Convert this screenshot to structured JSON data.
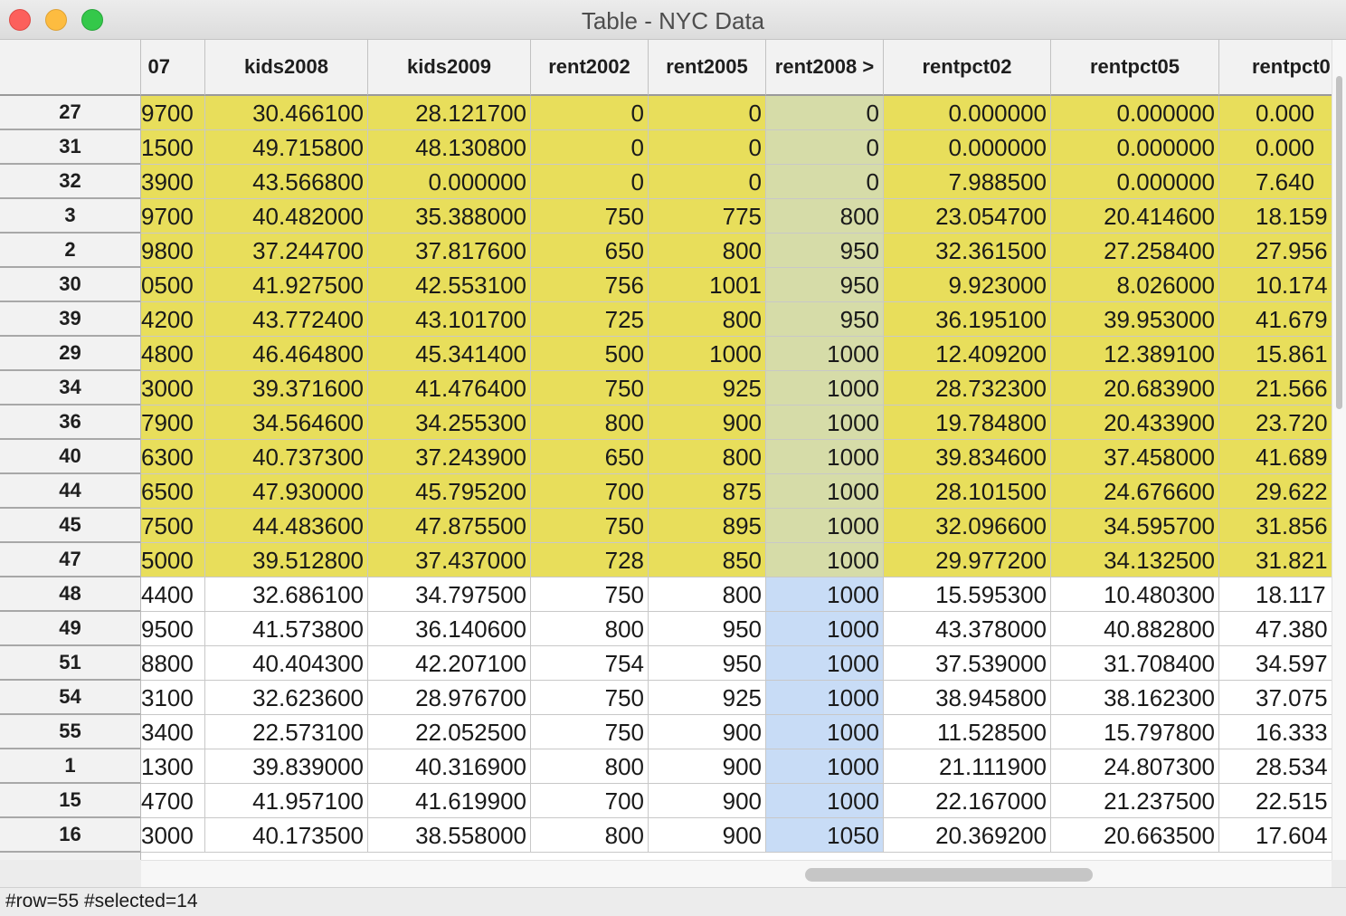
{
  "window": {
    "title": "Table - NYC Data"
  },
  "columns": [
    "07",
    "kids2008",
    "kids2009",
    "rent2002",
    "rent2005",
    "rent2008 >",
    "rentpct02",
    "rentpct05",
    "rentpct0"
  ],
  "rows": [
    {
      "id": "27",
      "selected": true,
      "cells": [
        "9700",
        "30.466100",
        "28.121700",
        "0",
        "0",
        "0",
        "0.000000",
        "0.000000",
        "0.000"
      ]
    },
    {
      "id": "31",
      "selected": true,
      "cells": [
        "1500",
        "49.715800",
        "48.130800",
        "0",
        "0",
        "0",
        "0.000000",
        "0.000000",
        "0.000"
      ]
    },
    {
      "id": "32",
      "selected": true,
      "cells": [
        "3900",
        "43.566800",
        "0.000000",
        "0",
        "0",
        "0",
        "7.988500",
        "0.000000",
        "7.640"
      ]
    },
    {
      "id": "3",
      "selected": true,
      "cells": [
        "9700",
        "40.482000",
        "35.388000",
        "750",
        "775",
        "800",
        "23.054700",
        "20.414600",
        "18.159"
      ]
    },
    {
      "id": "2",
      "selected": true,
      "cells": [
        "9800",
        "37.244700",
        "37.817600",
        "650",
        "800",
        "950",
        "32.361500",
        "27.258400",
        "27.956"
      ]
    },
    {
      "id": "30",
      "selected": true,
      "cells": [
        "0500",
        "41.927500",
        "42.553100",
        "756",
        "1001",
        "950",
        "9.923000",
        "8.026000",
        "10.174"
      ]
    },
    {
      "id": "39",
      "selected": true,
      "cells": [
        "4200",
        "43.772400",
        "43.101700",
        "725",
        "800",
        "950",
        "36.195100",
        "39.953000",
        "41.679"
      ]
    },
    {
      "id": "29",
      "selected": true,
      "cells": [
        "4800",
        "46.464800",
        "45.341400",
        "500",
        "1000",
        "1000",
        "12.409200",
        "12.389100",
        "15.861"
      ]
    },
    {
      "id": "34",
      "selected": true,
      "cells": [
        "3000",
        "39.371600",
        "41.476400",
        "750",
        "925",
        "1000",
        "28.732300",
        "20.683900",
        "21.566"
      ]
    },
    {
      "id": "36",
      "selected": true,
      "cells": [
        "7900",
        "34.564600",
        "34.255300",
        "800",
        "900",
        "1000",
        "19.784800",
        "20.433900",
        "23.720"
      ]
    },
    {
      "id": "40",
      "selected": true,
      "cells": [
        "6300",
        "40.737300",
        "37.243900",
        "650",
        "800",
        "1000",
        "39.834600",
        "37.458000",
        "41.689"
      ]
    },
    {
      "id": "44",
      "selected": true,
      "cells": [
        "6500",
        "47.930000",
        "45.795200",
        "700",
        "875",
        "1000",
        "28.101500",
        "24.676600",
        "29.622"
      ]
    },
    {
      "id": "45",
      "selected": true,
      "cells": [
        "7500",
        "44.483600",
        "47.875500",
        "750",
        "895",
        "1000",
        "32.096600",
        "34.595700",
        "31.856"
      ]
    },
    {
      "id": "47",
      "selected": true,
      "cells": [
        "5000",
        "39.512800",
        "37.437000",
        "728",
        "850",
        "1000",
        "29.977200",
        "34.132500",
        "31.821"
      ]
    },
    {
      "id": "48",
      "selected": false,
      "cells": [
        "4400",
        "32.686100",
        "34.797500",
        "750",
        "800",
        "1000",
        "15.595300",
        "10.480300",
        "18.117"
      ]
    },
    {
      "id": "49",
      "selected": false,
      "cells": [
        "9500",
        "41.573800",
        "36.140600",
        "800",
        "950",
        "1000",
        "43.378000",
        "40.882800",
        "47.380"
      ]
    },
    {
      "id": "51",
      "selected": false,
      "cells": [
        "8800",
        "40.404300",
        "42.207100",
        "754",
        "950",
        "1000",
        "37.539000",
        "31.708400",
        "34.597"
      ]
    },
    {
      "id": "54",
      "selected": false,
      "cells": [
        "3100",
        "32.623600",
        "28.976700",
        "750",
        "925",
        "1000",
        "38.945800",
        "38.162300",
        "37.075"
      ]
    },
    {
      "id": "55",
      "selected": false,
      "cells": [
        "3400",
        "22.573100",
        "22.052500",
        "750",
        "900",
        "1000",
        "11.528500",
        "15.797800",
        "16.333"
      ]
    },
    {
      "id": "1",
      "selected": false,
      "cells": [
        "1300",
        "39.839000",
        "40.316900",
        "800",
        "900",
        "1000",
        "21.111900",
        "24.807300",
        "28.534"
      ]
    },
    {
      "id": "15",
      "selected": false,
      "cells": [
        "4700",
        "41.957100",
        "41.619900",
        "700",
        "900",
        "1000",
        "22.167000",
        "21.237500",
        "22.515"
      ]
    },
    {
      "id": "16",
      "selected": false,
      "cells": [
        "3000",
        "40.173500",
        "38.558000",
        "800",
        "900",
        "1050",
        "20.369200",
        "20.663500",
        "17.604"
      ]
    }
  ],
  "status": "#row=55 #selected=14",
  "colors": {
    "selected": "#e8de5b",
    "sorted_selected": "#d6dca8",
    "sorted_unselected": "#c8dcf6"
  }
}
